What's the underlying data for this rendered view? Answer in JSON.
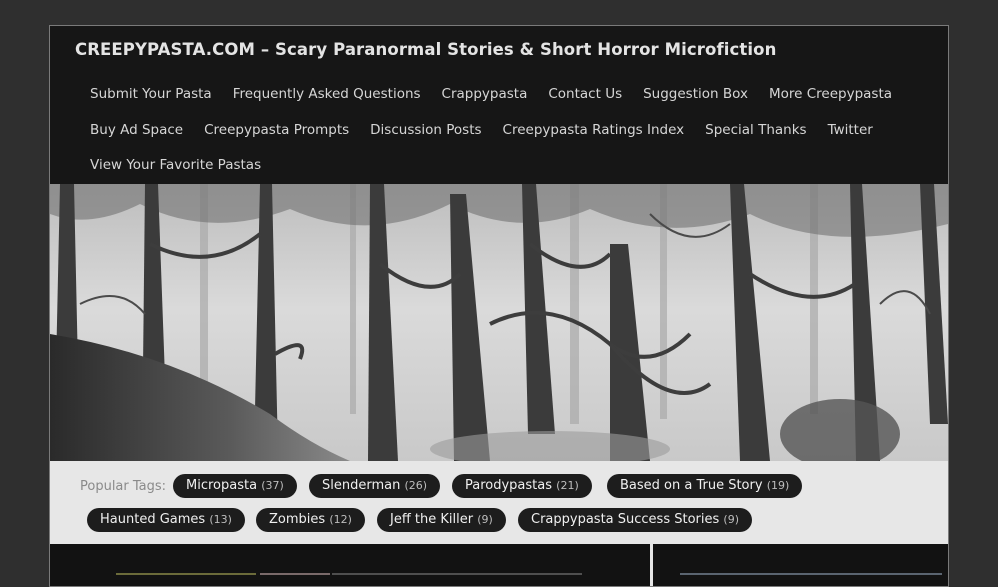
{
  "site": {
    "title": "CREEPYPASTA.COM – Scary Paranormal Stories & Short Horror Microfiction"
  },
  "nav": {
    "rows": [
      [
        "Submit Your Pasta",
        "Frequently Asked Questions",
        "Crappypasta",
        "Contact Us",
        "Suggestion Box",
        "More Creepypasta"
      ],
      [
        "Buy Ad Space",
        "Creepypasta Prompts",
        "Discussion Posts",
        "Creepypasta Ratings Index",
        "Special Thanks",
        "Twitter"
      ],
      [
        "View Your Favorite Pastas"
      ]
    ]
  },
  "banner": {
    "description_icon": "misty-forest-image",
    "colors": {
      "mist": "#dcdcdc",
      "tree": "#3a3a3a",
      "ground": "#2e2e2e"
    }
  },
  "tags": {
    "label": "Popular Tags:",
    "items": [
      {
        "name": "Micropasta",
        "count": "(37)"
      },
      {
        "name": "Slenderman",
        "count": "(26)"
      },
      {
        "name": "Parodypastas",
        "count": "(21)"
      },
      {
        "name": "Based on a True Story",
        "count": "(19)"
      },
      {
        "name": "Haunted Games",
        "count": "(13)"
      },
      {
        "name": "Zombies",
        "count": "(12)"
      },
      {
        "name": "Jeff the Killer",
        "count": "(9)"
      },
      {
        "name": "Crappypasta Success Stories",
        "count": "(9)"
      }
    ]
  },
  "colors": {
    "page_bg": "#2f2f2f",
    "header_bg": "#161616",
    "tag_bg": "#e7e7e7",
    "pill_bg": "#1d1d1d"
  }
}
